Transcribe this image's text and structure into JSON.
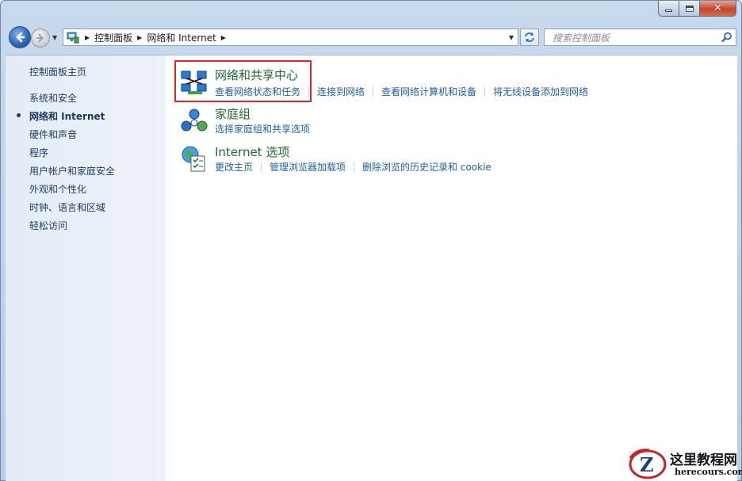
{
  "address": {
    "crumbs": [
      "控制面板",
      "网络和 Internet"
    ]
  },
  "search": {
    "placeholder": "搜索控制面板"
  },
  "sidebar": {
    "home": "控制面板主页",
    "items": [
      {
        "label": "系统和安全",
        "active": false
      },
      {
        "label": "网络和 Internet",
        "active": true
      },
      {
        "label": "硬件和声音",
        "active": false
      },
      {
        "label": "程序",
        "active": false
      },
      {
        "label": "用户帐户和家庭安全",
        "active": false
      },
      {
        "label": "外观和个性化",
        "active": false
      },
      {
        "label": "时钟、语言和区域",
        "active": false
      },
      {
        "label": "轻松访问",
        "active": false
      }
    ]
  },
  "categories": [
    {
      "title": "网络和共享中心",
      "icon": "network-sharing-icon",
      "links": [
        "查看网络状态和任务",
        "连接到网络",
        "查看网络计算机和设备",
        "将无线设备添加到网络"
      ]
    },
    {
      "title": "家庭组",
      "icon": "homegroup-icon",
      "links": [
        "选择家庭组和共享选项"
      ]
    },
    {
      "title": "Internet 选项",
      "icon": "internet-options-icon",
      "links": [
        "更改主页",
        "管理浏览器加载项",
        "删除浏览的历史记录和 cookie"
      ]
    }
  ],
  "watermark": {
    "cn": "这里教程网",
    "en": "herecours.com"
  },
  "colors": {
    "link": "#1e5fa8",
    "category_title": "#1f6b2c",
    "highlight": "#d9262d",
    "sidebar_text": "#1e395b"
  }
}
